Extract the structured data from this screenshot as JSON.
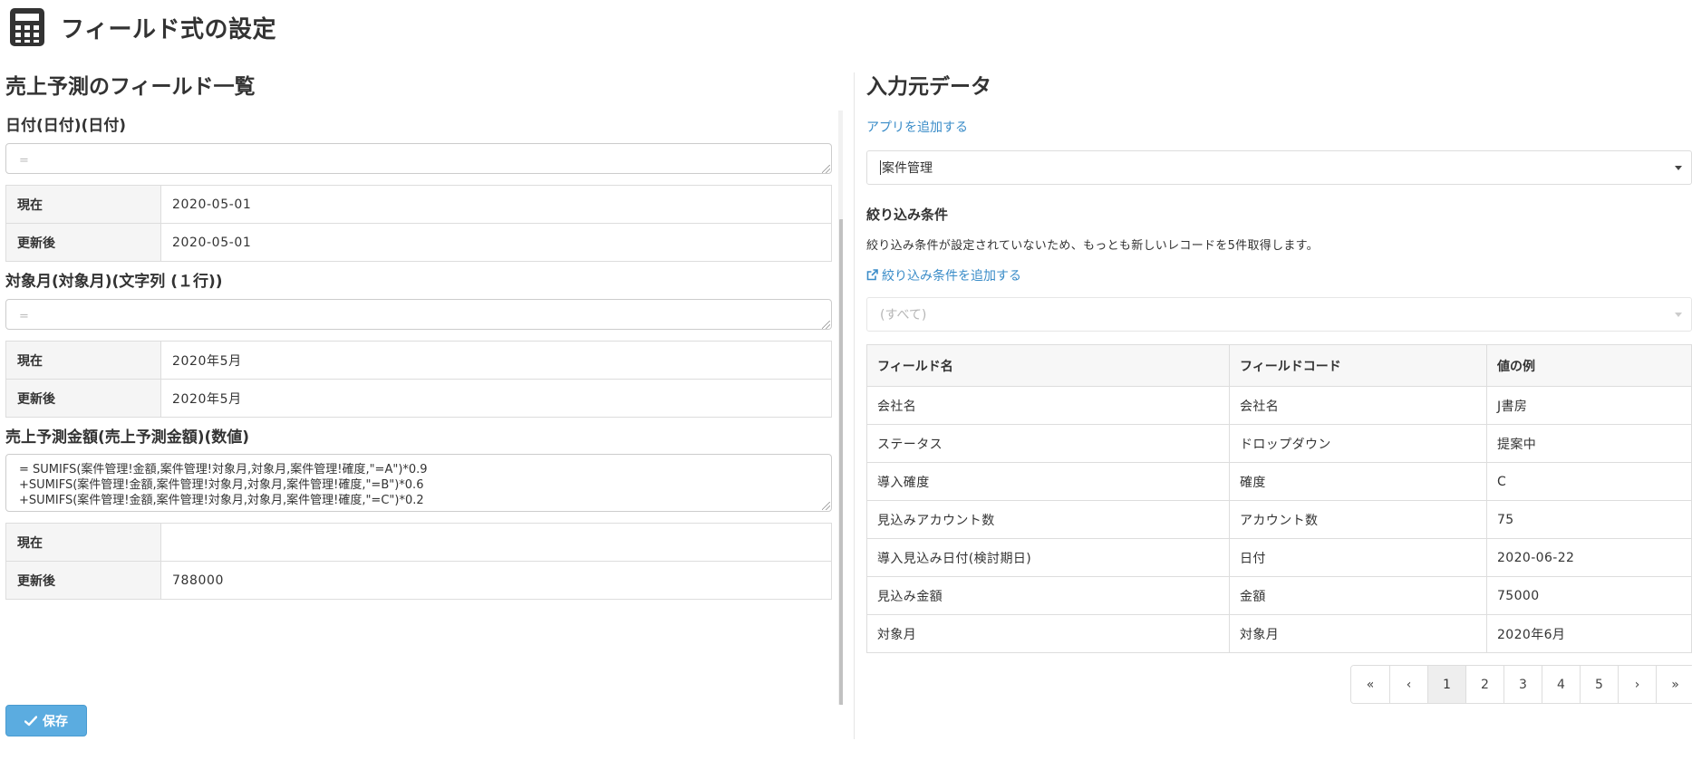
{
  "header": {
    "title": "フィールド式の設定",
    "icon": "calculator-icon"
  },
  "left": {
    "heading": "売上予測のフィールド一覧",
    "fields": [
      {
        "label": "日付(日付)(日付)",
        "formula": "=",
        "formula_is_placeholder": true,
        "rows": [
          {
            "name": "現在",
            "value": "2020-05-01"
          },
          {
            "name": "更新後",
            "value": "2020-05-01"
          }
        ]
      },
      {
        "label": "対象月(対象月)(文字列 (１行))",
        "formula": "=",
        "formula_is_placeholder": true,
        "rows": [
          {
            "name": "現在",
            "value": "2020年5月"
          },
          {
            "name": "更新後",
            "value": "2020年5月"
          }
        ]
      },
      {
        "label": "売上予測金額(売上予測金額)(数値)",
        "formula": "= SUMIFS(案件管理!金額,案件管理!対象月,対象月,案件管理!確度,\"=A\")*0.9\n+SUMIFS(案件管理!金額,案件管理!対象月,対象月,案件管理!確度,\"=B\")*0.6\n+SUMIFS(案件管理!金額,案件管理!対象月,対象月,案件管理!確度,\"=C\")*0.2",
        "formula_is_placeholder": false,
        "rows": [
          {
            "name": "現在",
            "value": ""
          },
          {
            "name": "更新後",
            "value": "788000"
          }
        ]
      }
    ],
    "save_label": "保存"
  },
  "right": {
    "heading": "入力元データ",
    "add_app_link": "アプリを追加する",
    "app_select_value": "案件管理",
    "filter_heading": "絞り込み条件",
    "filter_help": "絞り込み条件が設定されていないため、もっとも新しいレコードを5件取得します。",
    "add_filter_link": "絞り込み条件を追加する",
    "filter_select_value": "(すべて)",
    "table": {
      "headers": [
        "フィールド名",
        "フィールドコード",
        "値の例"
      ],
      "rows": [
        [
          "会社名",
          "会社名",
          "J書房"
        ],
        [
          "ステータス",
          "ドロップダウン",
          "提案中"
        ],
        [
          "導入確度",
          "確度",
          "C"
        ],
        [
          "見込みアカウント数",
          "アカウント数",
          "75"
        ],
        [
          "導入見込み日付(検討期日)",
          "日付",
          "2020-06-22"
        ],
        [
          "見込み金額",
          "金額",
          "75000"
        ],
        [
          "対象月",
          "対象月",
          "2020年6月"
        ]
      ]
    },
    "pagination": [
      "«",
      "‹",
      "1",
      "2",
      "3",
      "4",
      "5",
      "›",
      "»"
    ],
    "pagination_active": "1"
  },
  "colors": {
    "accent": "#5bace0",
    "link": "#3a8cc8",
    "border": "#dddddd",
    "header_bg": "#f5f5f5"
  }
}
